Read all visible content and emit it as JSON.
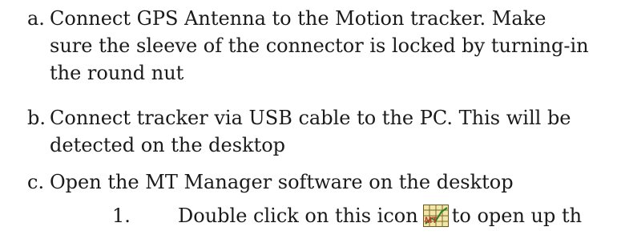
{
  "steps": [
    {
      "marker": "a.",
      "lines": [
        "Connect GPS Antenna to the Motion tracker. Make",
        "sure the sleeve of the connector is locked by turning-in",
        "the round nut"
      ]
    },
    {
      "marker": "b.",
      "lines": [
        "Connect tracker via USB cable to the PC. This will be",
        "detected on the desktop"
      ]
    },
    {
      "marker": "c.",
      "lines": [
        "Open the MT Manager software on the desktop"
      ],
      "substep": {
        "marker": "1.",
        "text_before_icon": "Double click on this icon",
        "icon": "mt-manager-app-icon",
        "icon_text": "MT",
        "text_after_icon": "to open up th"
      }
    }
  ]
}
